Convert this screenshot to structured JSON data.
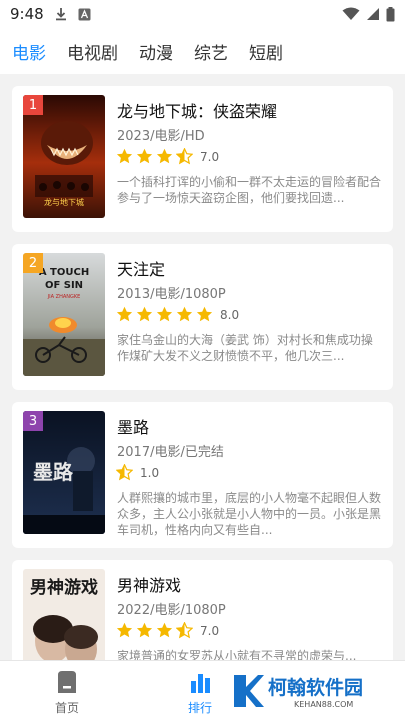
{
  "status_bar": {
    "time": "9:48"
  },
  "tabs": [
    {
      "label": "电影",
      "active": true
    },
    {
      "label": "电视剧",
      "active": false
    },
    {
      "label": "动漫",
      "active": false
    },
    {
      "label": "综艺",
      "active": false
    },
    {
      "label": "短剧",
      "active": false
    }
  ],
  "movies": [
    {
      "rank": "1",
      "rank_color": "#e8463c",
      "title": "龙与地下城：侠盗荣耀",
      "meta": "2023/电影/HD",
      "rating": "7.0",
      "stars": 3.5,
      "desc": "一个插科打诨的小偷和一群不太走运的冒险者配合参与了一场惊天盗窃企图，他们要找回遗..."
    },
    {
      "rank": "2",
      "rank_color": "#f5a623",
      "title": "天注定",
      "meta": "2013/电影/1080P",
      "rating": "8.0",
      "stars": 5,
      "desc": "家住乌金山的大海（姜武 饰）对村长和焦成功操作煤矿大发不义之财愤愤不平，他几次三..."
    },
    {
      "rank": "3",
      "rank_color": "#8e44ad",
      "title": "墨路",
      "meta": "2017/电影/已完结",
      "rating": "1.0",
      "stars": 0.5,
      "desc": "人群熙攘的城市里，底层的小人物毫不起眼但人数众多，主人公小张就是小人物中的一员。小张是黑车司机，性格内向又有些自..."
    },
    {
      "rank": "",
      "rank_color": "",
      "title": "男神游戏",
      "meta": "2022/电影/1080P",
      "rating": "7.0",
      "stars": 3.5,
      "desc": "家境普通的女罗苏从小就有不寻常的虚荣与..."
    }
  ],
  "posters": [
    {
      "text_top": "",
      "text_main": "龙与地下城",
      "colors": [
        "#3a0d05",
        "#b8360f"
      ]
    },
    {
      "text_top": "A TOUCH OF SIN",
      "text_main": "",
      "colors": [
        "#cfd3d4",
        "#3a3f32"
      ]
    },
    {
      "text_top": "",
      "text_main": "墨路",
      "colors": [
        "#0b1426",
        "#1c2d47"
      ]
    },
    {
      "text_top": "",
      "text_main": "男神游戏",
      "colors": [
        "#f3ece6",
        "#6b4a3c"
      ]
    }
  ],
  "bottom_nav": {
    "home_label": "首页",
    "rank_label": "排行"
  },
  "watermark": {
    "text": "柯翰软件园",
    "url": "KEHAN88.COM"
  },
  "colors": {
    "accent": "#1a8cff",
    "star": "#f5b800"
  }
}
